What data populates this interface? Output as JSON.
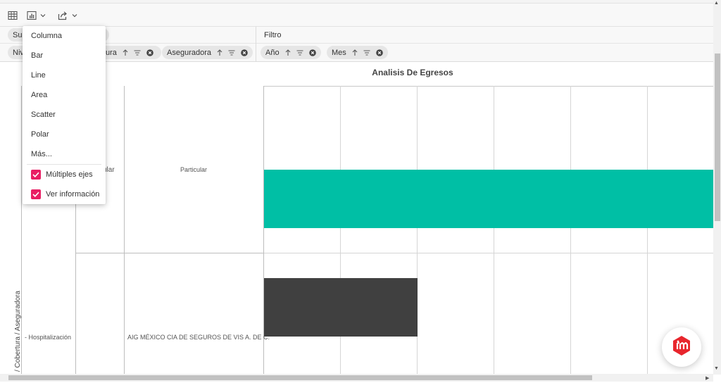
{
  "toolbar": {
    "icons": [
      "table-icon",
      "chart-icon",
      "export-icon"
    ]
  },
  "fields": {
    "row1_pill": "Su",
    "filter_label": "Filtro",
    "row_pills": [
      {
        "label": "Niv"
      },
      {
        "label": "ura"
      },
      {
        "label": "Aseguradora"
      }
    ],
    "filter_pills": [
      {
        "label": "Año"
      },
      {
        "label": "Mes"
      }
    ]
  },
  "chart_menu": {
    "items": [
      "Columna",
      "Bar",
      "Line",
      "Area",
      "Scatter",
      "Polar",
      "Más..."
    ],
    "checkboxes": [
      {
        "label": "Múltiples ejes",
        "checked": true
      },
      {
        "label": "Ver información",
        "checked": true
      }
    ],
    "check_color": "#e91e63"
  },
  "grid": {
    "title": "Analisis De Egresos",
    "axis_label": "/ Cobertura / Aseguradora",
    "rows": [
      {
        "level1": "ular",
        "level2": "Particular",
        "bar_color": "#00bfa5",
        "bar_fraction": 1.0
      },
      {
        "level1": "- Hospitalización",
        "level2": "AIG MÉXICO CIA DE SEGUROS DE VIS A. DE C.",
        "bar_color": "#404040",
        "bar_fraction": 0.342
      }
    ]
  },
  "fab": {
    "logo_color": "#e8262d"
  }
}
